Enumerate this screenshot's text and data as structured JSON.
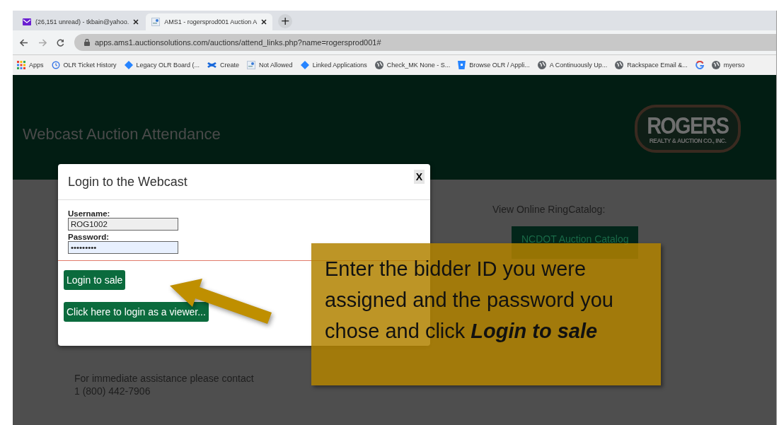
{
  "browser": {
    "tabs": [
      {
        "title": "(26,151 unread) - tkbain@yahoo.",
        "kind": "mail",
        "selected": false
      },
      {
        "title": "AMS1 - rogersprod001 Auction A",
        "kind": "page",
        "selected": true
      }
    ],
    "new_tab": "+",
    "address": "apps.ams1.auctionsolutions.com/auctions/attend_links.php?name=rogersprod001#",
    "bookmarks": [
      {
        "label": "Apps",
        "kind": "apps"
      },
      {
        "label": "OLR Ticket History",
        "kind": "history"
      },
      {
        "label": "Legacy OLR Board (...",
        "kind": "diamond"
      },
      {
        "label": "Create",
        "kind": "confluence"
      },
      {
        "label": "Not Allowed",
        "kind": "page"
      },
      {
        "label": "Linked Applications",
        "kind": "diamond"
      },
      {
        "label": "Check_MK None - S...",
        "kind": "globe"
      },
      {
        "label": "Browse OLR / Appli...",
        "kind": "bitbucket"
      },
      {
        "label": "A Continuously Up...",
        "kind": "globe"
      },
      {
        "label": "Rackspace Email &...",
        "kind": "globe"
      },
      {
        "kind": "google"
      },
      {
        "label": "myerso",
        "kind": "globe"
      }
    ]
  },
  "page": {
    "title": "Webcast Auction Attendance",
    "logo": {
      "name": "ROGERS",
      "subtitle": "REALTY & AUCTION CO., INC."
    },
    "catalog_label": "View Online RingCatalog:",
    "catalog_button": "NCDOT Auction Catalog",
    "contact": [
      "For immediate assistance please contact",
      "1 (800) 442-7906"
    ]
  },
  "dialog": {
    "title": "Login to the Webcast",
    "close": "X",
    "fields": [
      {
        "label": "Username:",
        "value": "ROG1002",
        "focused": false
      },
      {
        "label": "Password:",
        "value": "•••••••••",
        "focused": true
      }
    ],
    "buttons": [
      "Login to sale",
      "Click here to login as a viewer..."
    ]
  },
  "callout": {
    "text": "Enter the bidder ID you were assigned and the password you chose and click **Login to sale**"
  }
}
